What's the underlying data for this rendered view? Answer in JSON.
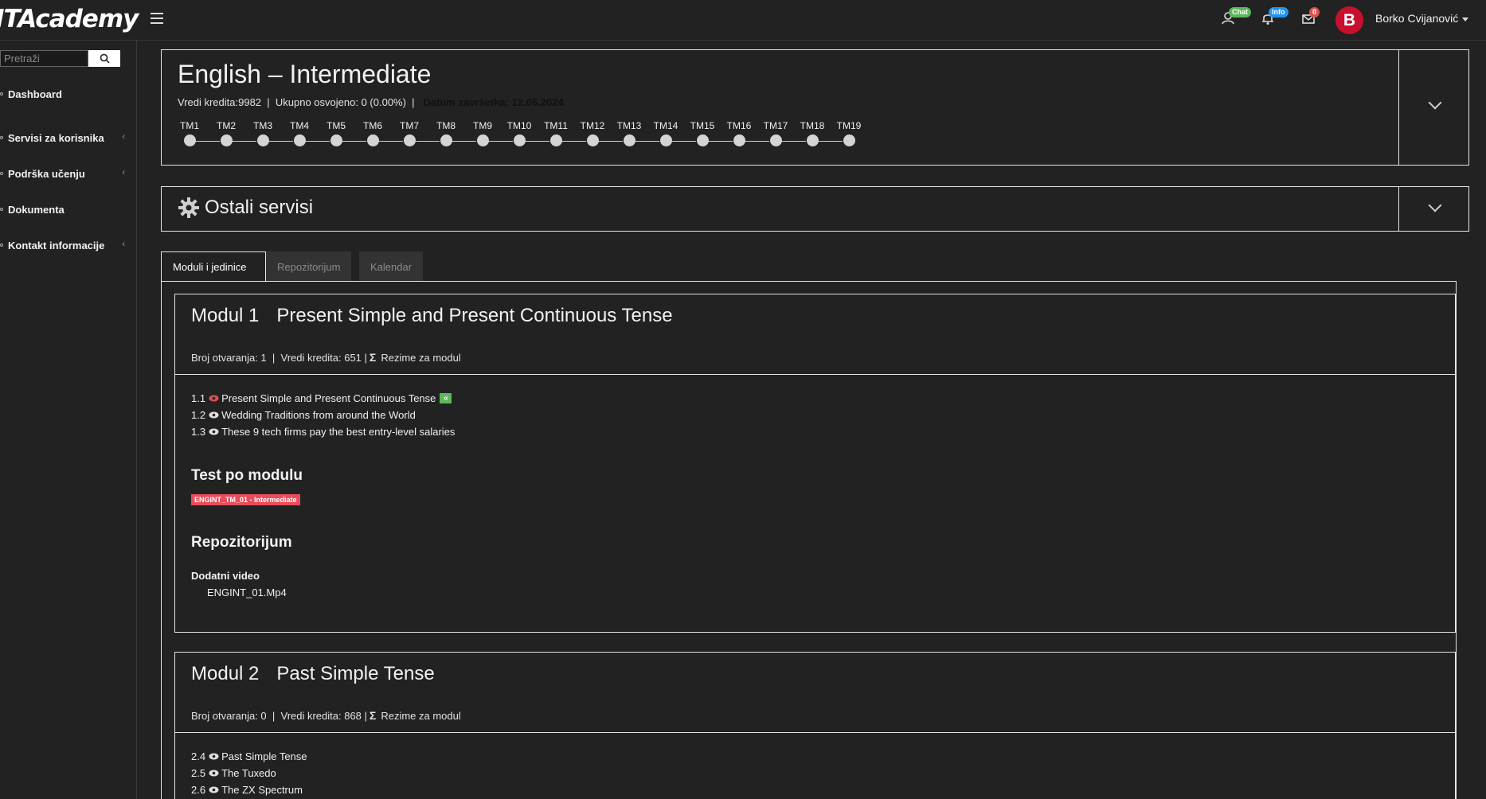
{
  "header": {
    "logo": "ITAcademy",
    "badges": {
      "chat": "Chat",
      "info": "Info",
      "messages": "0"
    },
    "avatar_letter": "B",
    "username": "Borko Cvijanović"
  },
  "sidebar": {
    "search_placeholder": "Pretraži",
    "items": [
      {
        "label": "Dashboard",
        "has_chevron": false
      },
      {
        "label": "Servisi za korisnika",
        "has_chevron": true
      },
      {
        "label": "Podrška učenju",
        "has_chevron": true
      },
      {
        "label": "Dokumenta",
        "has_chevron": false
      },
      {
        "label": "Kontakt informacije",
        "has_chevron": true
      }
    ],
    "chevron": "‹"
  },
  "course": {
    "title": "English – Intermediate",
    "credits": "Vredi kredita:9982",
    "earned": "Ukupno osvojeno: 0 (0.00%)",
    "deadline": "Datum završetka: 12.06.2024",
    "separator": "|",
    "milestones": [
      "TM1",
      "TM2",
      "TM3",
      "TM4",
      "TM5",
      "TM6",
      "TM7",
      "TM8",
      "TM9",
      "TM10",
      "TM11",
      "TM12",
      "TM13",
      "TM14",
      "TM15",
      "TM16",
      "TM17",
      "TM18",
      "TM19"
    ]
  },
  "other_services": {
    "title": "Ostali servisi"
  },
  "tabs": [
    {
      "label": "Moduli i jedinice",
      "active": true
    },
    {
      "label": "Repozitorijum",
      "active": false
    },
    {
      "label": "Kalendar",
      "active": false
    }
  ],
  "modules": [
    {
      "number": "Modul 1",
      "title": "Present Simple and Present Continuous Tense",
      "opens": "Broj otvaranja: 1",
      "credits": "Vredi kredita: 651",
      "summary": "Rezime za modul",
      "units": [
        {
          "num": "1.1",
          "title": "Present Simple and Present Continuous Tense",
          "eye_color": "#d9534f",
          "current": true
        },
        {
          "num": "1.2",
          "title": "Wedding Traditions from around the World",
          "eye_color": "#e0e0e0",
          "current": false
        },
        {
          "num": "1.3",
          "title": "These 9 tech firms pay the best entry-level salaries",
          "eye_color": "#e0e0e0",
          "current": false
        }
      ],
      "test_heading": "Test po modulu",
      "test_badge": "ENGINT_TM_01 - Intermediate",
      "repo_heading": "Repozitorijum",
      "repo_sub": "Dodatni video",
      "repo_file": "ENGINT_01.Mp4"
    },
    {
      "number": "Modul 2",
      "title": "Past Simple Tense",
      "opens": "Broj otvaranja: 0",
      "credits": "Vredi kredita: 868",
      "summary": "Rezime za modul",
      "units": [
        {
          "num": "2.4",
          "title": "Past Simple Tense"
        },
        {
          "num": "2.5",
          "title": "The Tuxedo"
        },
        {
          "num": "2.6",
          "title": "The ZX Spectrum"
        }
      ]
    }
  ],
  "colors": {
    "accent_red": "#c8102e",
    "badge_green": "#5cb85c",
    "badge_blue": "#2196f3",
    "test_red": "#e84d5b"
  }
}
